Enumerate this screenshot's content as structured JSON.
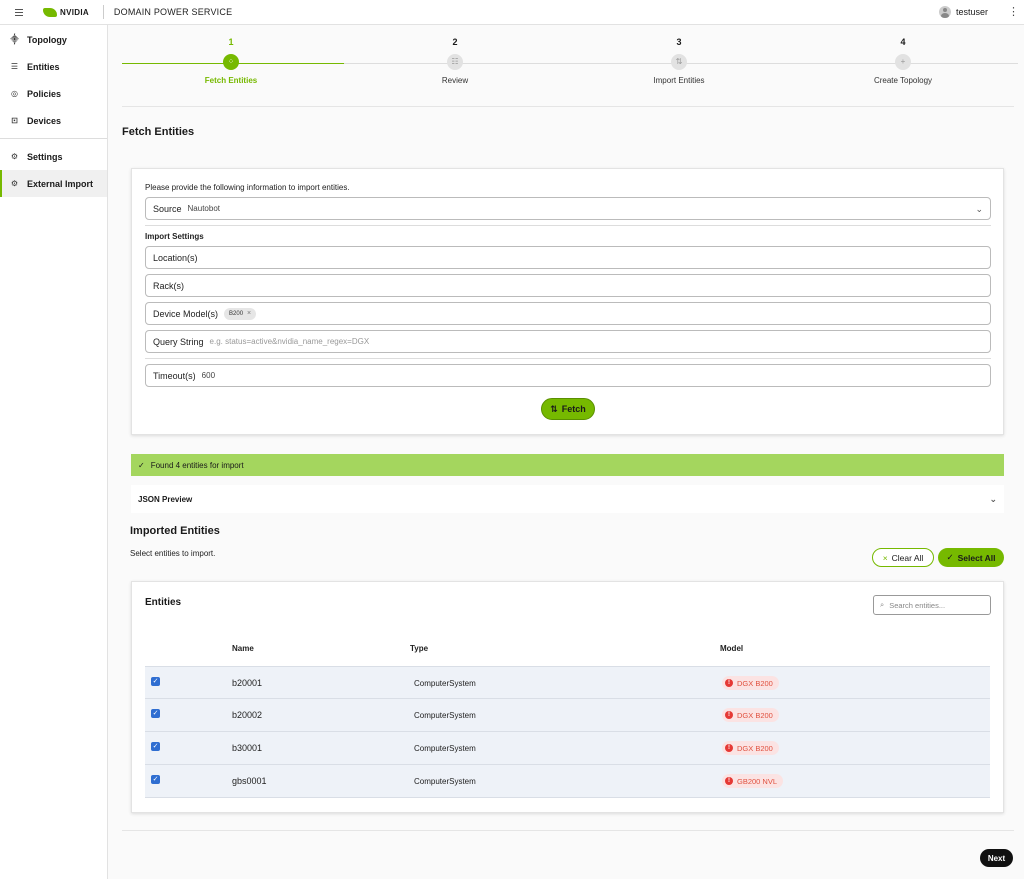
{
  "topbar": {
    "brand": "NVIDIA",
    "app_title": "DOMAIN POWER SERVICE",
    "username": "testuser"
  },
  "sidebar": {
    "items": [
      {
        "label": "Topology",
        "icon": "topology-icon"
      },
      {
        "label": "Entities",
        "icon": "entities-icon"
      },
      {
        "label": "Policies",
        "icon": "policies-icon"
      },
      {
        "label": "Devices",
        "icon": "devices-icon"
      },
      {
        "label": "Settings",
        "icon": "gear-icon"
      },
      {
        "label": "External Import",
        "icon": "external-import-icon"
      }
    ],
    "active": "External Import"
  },
  "stepper": {
    "steps": [
      {
        "num": "1",
        "label": "Fetch Entities"
      },
      {
        "num": "2",
        "label": "Review"
      },
      {
        "num": "3",
        "label": "Import Entities"
      },
      {
        "num": "4",
        "label": "Create Topology"
      }
    ],
    "current": 1
  },
  "fetch": {
    "title": "Fetch Entities",
    "hint": "Please provide the following information to import entities.",
    "source_label": "Source",
    "source_value": "Nautobot",
    "settings_label": "Import Settings",
    "location_label": "Location(s)",
    "rack_label": "Rack(s)",
    "device_model_label": "Device Model(s)",
    "device_model_chip": "B200",
    "query_label": "Query String",
    "query_placeholder": "e.g. status=active&nvidia_name_regex=DGX",
    "timeout_label": "Timeout(s)",
    "timeout_value": "600",
    "fetch_button": "Fetch"
  },
  "result": {
    "banner": "Found 4 entities for import",
    "json_preview": "JSON Preview"
  },
  "imported": {
    "title": "Imported Entities",
    "hint": "Select entities to import.",
    "clear_all": "Clear All",
    "select_all": "Select All",
    "card_title": "Entities",
    "search_placeholder": "Search entities...",
    "columns": [
      "Name",
      "Type",
      "Model"
    ],
    "rows": [
      {
        "name": "b20001",
        "type": "ComputerSystem",
        "model": "DGX B200",
        "checked": true
      },
      {
        "name": "b20002",
        "type": "ComputerSystem",
        "model": "DGX B200",
        "checked": true
      },
      {
        "name": "b30001",
        "type": "ComputerSystem",
        "model": "DGX B200",
        "checked": true
      },
      {
        "name": "gbs0001",
        "type": "ComputerSystem",
        "model": "GB200 NVL",
        "checked": true
      }
    ]
  },
  "footer": {
    "next_button": "Next"
  },
  "colors": {
    "accent": "#76b900",
    "banner": "#a4d65e",
    "error": "#e53935",
    "checkbox": "#2f6ed1"
  }
}
